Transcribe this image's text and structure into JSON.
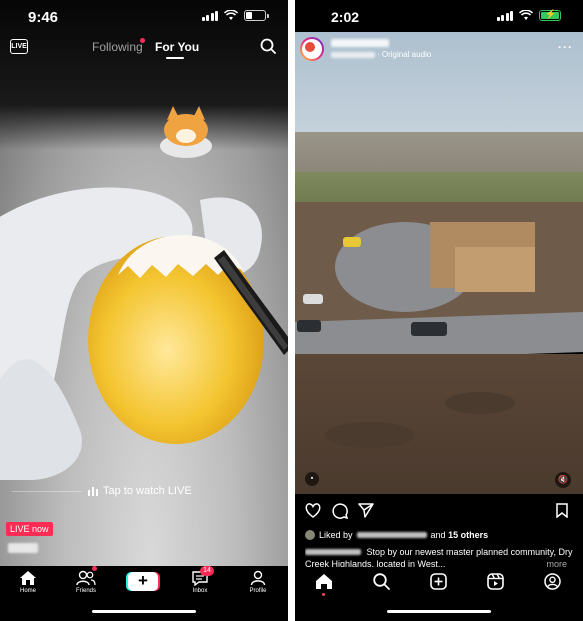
{
  "tiktok": {
    "status_time": "9:46",
    "tabs": {
      "following": "Following",
      "for_you": "For You"
    },
    "live_icon_label": "LIVE",
    "tap_to_watch": "Tap to watch LIVE",
    "live_badge": "LIVE now",
    "nav": {
      "home": "Home",
      "friends": "Friends",
      "create": "+",
      "inbox": "Inbox",
      "profile": "Profile",
      "inbox_badge": "14"
    },
    "progress": {
      "battery_percent": 0.35
    }
  },
  "instagram": {
    "status_time": "2:02",
    "header": {
      "audio": "· Original audio",
      "more": "···"
    },
    "liked_by_prefix": "Liked by",
    "liked_by_suffix": "and",
    "liked_by_others": "15 others",
    "caption_text": "Stop by our newest master planned community, Dry Creek Highlands, located in West...",
    "caption_more": "more"
  },
  "colors": {
    "tiktok_accent": "#fe2c55",
    "tiktok_cyan": "#25f4ee",
    "ig_battery": "#34c759",
    "ig_notification": "#ed4956"
  }
}
